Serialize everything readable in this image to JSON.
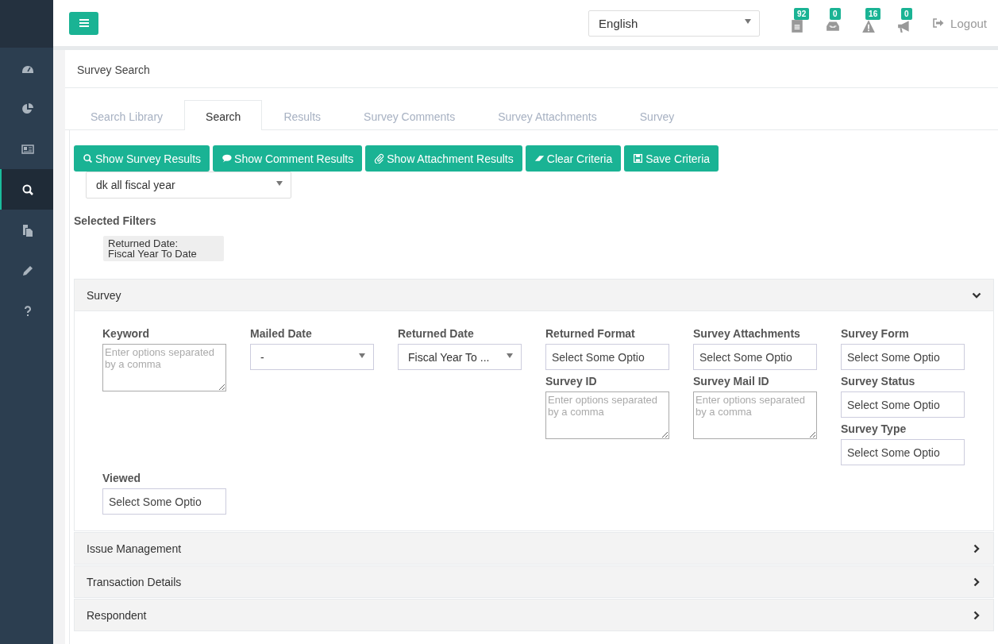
{
  "sidebar": {
    "items": [
      {
        "kind": "dashboard",
        "selected": false
      },
      {
        "kind": "pie",
        "selected": false
      },
      {
        "kind": "newspaper",
        "selected": false
      },
      {
        "kind": "search",
        "selected": true
      },
      {
        "kind": "copy",
        "selected": false
      },
      {
        "kind": "pencil",
        "selected": false
      },
      {
        "kind": "question",
        "selected": false
      }
    ]
  },
  "topbar": {
    "language": "English",
    "notifications": [
      {
        "kind": "document",
        "count": "92"
      },
      {
        "kind": "inbox",
        "count": "0"
      },
      {
        "kind": "warning",
        "count": "16"
      },
      {
        "kind": "megaphone",
        "count": "0"
      }
    ],
    "logout": "Logout"
  },
  "page_title": "Survey Search",
  "tabs": [
    {
      "label": "Search Library",
      "selected": false
    },
    {
      "label": "Search",
      "selected": true
    },
    {
      "label": "Results",
      "selected": false
    },
    {
      "label": "Survey Comments",
      "selected": false
    },
    {
      "label": "Survey Attachments",
      "selected": false
    },
    {
      "label": "Survey",
      "selected": false
    }
  ],
  "actions": [
    {
      "kind": "search",
      "label": "Show Survey Results"
    },
    {
      "kind": "comment",
      "label": "Show Comment Results"
    },
    {
      "kind": "paperclip",
      "label": "Show Attachment Results"
    },
    {
      "kind": "eraser",
      "label": "Clear Criteria"
    },
    {
      "kind": "save",
      "label": "Save Criteria"
    }
  ],
  "saved_search": "dk all fiscal year",
  "selected_filters": {
    "title": "Selected Filters",
    "items": [
      {
        "line1": "Returned Date:",
        "line2": "Fiscal Year To Date"
      }
    ]
  },
  "panels": [
    {
      "title": "Survey",
      "expanded": true,
      "rows": [
        [
          [
            {
              "label": "Keyword",
              "kind": "textarea",
              "placeholder": "Enter options separated by a comma"
            }
          ],
          [
            {
              "label": "Mailed Date",
              "kind": "select",
              "value": "-"
            }
          ],
          [
            {
              "label": "Returned Date",
              "kind": "select",
              "value": "Fiscal Year To ..."
            }
          ],
          [
            {
              "label": "Returned Format",
              "kind": "multiselect",
              "placeholder": "Select Some Optio"
            },
            {
              "label": "Survey ID",
              "kind": "textarea",
              "placeholder": "Enter options separated by a comma"
            }
          ],
          [
            {
              "label": "Survey Attachments",
              "kind": "multiselect",
              "placeholder": "Select Some Optio"
            },
            {
              "label": "Survey Mail ID",
              "kind": "textarea",
              "placeholder": "Enter options separated by a comma"
            }
          ],
          [
            {
              "label": "Survey Form",
              "kind": "multiselect",
              "placeholder": "Select Some Optio"
            },
            {
              "label": "Survey Status",
              "kind": "multiselect",
              "placeholder": "Select Some Optio"
            },
            {
              "label": "Survey Type",
              "kind": "multiselect",
              "placeholder": "Select Some Optio"
            }
          ]
        ],
        [
          [
            {
              "label": "Viewed",
              "kind": "multiselect",
              "placeholder": "Select Some Optio"
            }
          ]
        ]
      ]
    },
    {
      "title": "Issue Management",
      "expanded": false
    },
    {
      "title": "Transaction Details",
      "expanded": false
    },
    {
      "title": "Respondent",
      "expanded": false
    }
  ]
}
